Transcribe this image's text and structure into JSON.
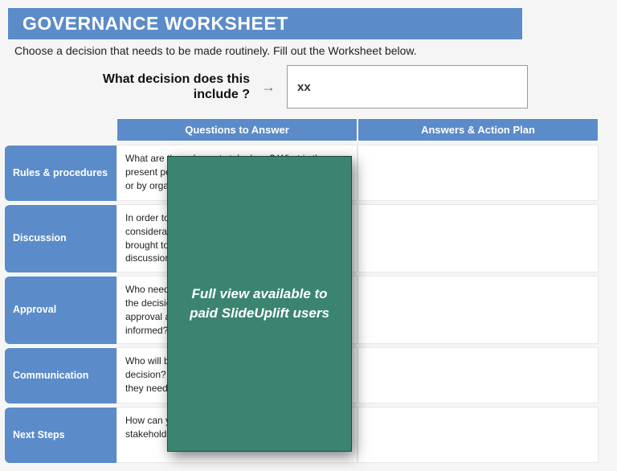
{
  "title": "GOVERNANCE WORKSHEET",
  "subtitle": "Choose a decision that needs to be made routinely. Fill out the Worksheet below.",
  "decision": {
    "question": "What decision does this include ?",
    "value": "xx"
  },
  "headers": {
    "questions": "Questions to Answer",
    "answers": "Answers & Action Plan"
  },
  "rows": [
    {
      "label": "Rules & procedures",
      "question": "What are the values at stake here? What is the present policy on this decision? Is it required by law or by organizational process?"
    },
    {
      "label": "Discussion",
      "question": "In order to influence the decision, what evidence, consideration or stories are necessary or could be brought to the table? What is required for a discussion"
    },
    {
      "label": "Approval",
      "question": "Who needs to be involved in this decision? How will the decision be taken, and at what levels of approval are required? How is it going to be informed?"
    },
    {
      "label": "Communication",
      "question": "Who will be affected by the outcome of this decision? When a decision has been taken, what do they need to know and from whom?"
    },
    {
      "label": "Next Steps",
      "question": "How can you ensure that all appropriate stakeholders follow the new decision through?"
    }
  ],
  "overlay": {
    "message": "Full view available to paid SlideUplift users"
  }
}
